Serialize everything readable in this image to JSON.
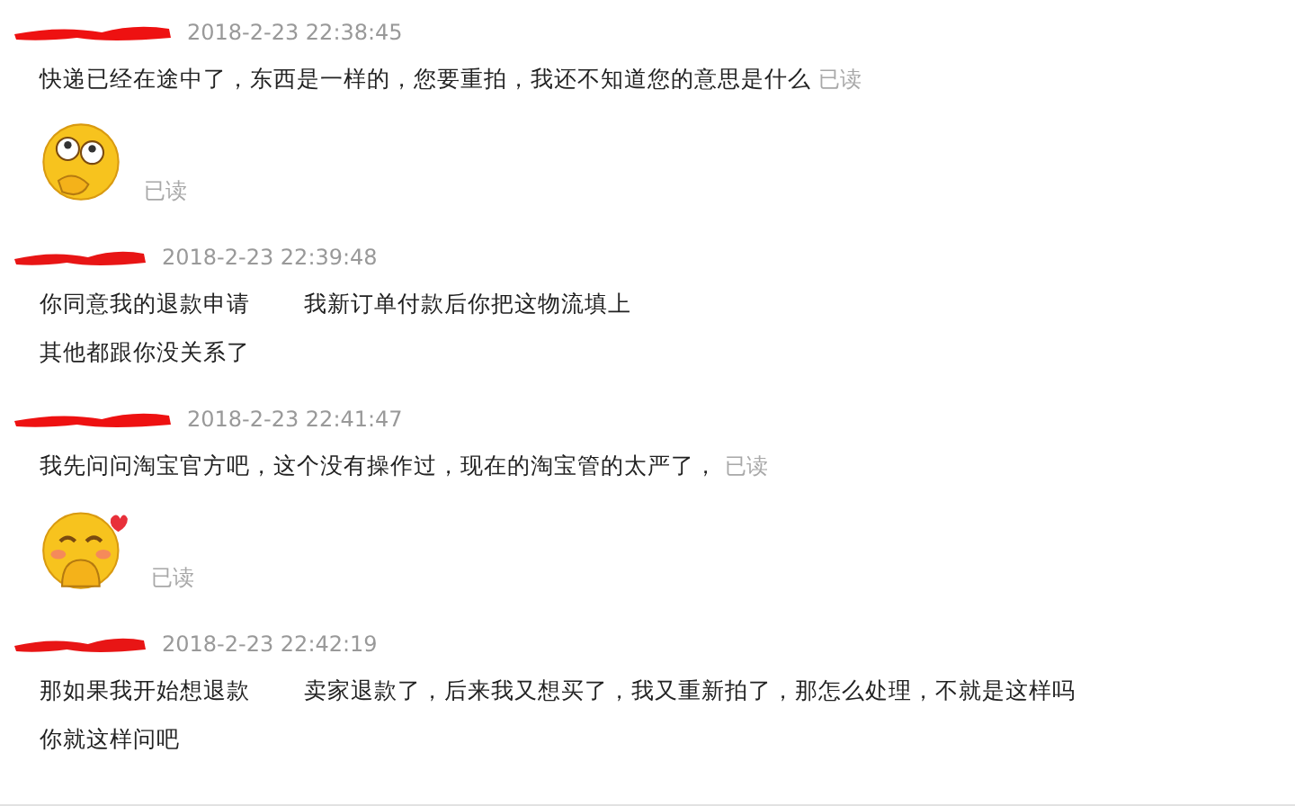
{
  "messages": [
    {
      "kind": "seller",
      "time": "2018-2-23 22:38:45",
      "items": [
        {
          "kind": "text",
          "segments": [
            "快递已经在途中了，东西是一样的，您要重拍，我还不知道您的意思是什么"
          ],
          "receipt": "已读"
        },
        {
          "kind": "thinking_emoji",
          "receipt": "已读"
        }
      ]
    },
    {
      "kind": "buyer",
      "time": "2018-2-23 22:39:48",
      "items": [
        {
          "kind": "text",
          "segments": [
            "你同意我的退款申请",
            "我新订单付款后你把这物流填上"
          ]
        },
        {
          "kind": "text",
          "segments": [
            "其他都跟你没关系了"
          ]
        }
      ]
    },
    {
      "kind": "seller",
      "time": "2018-2-23 22:41:47",
      "items": [
        {
          "kind": "text",
          "segments": [
            "我先问问淘宝官方吧，这个没有操作过，现在的淘宝管的太严了，"
          ],
          "receipt": "已读"
        },
        {
          "kind": "shy_emoji",
          "receipt": "已读"
        }
      ]
    },
    {
      "kind": "buyer",
      "time": "2018-2-23 22:42:19",
      "items": [
        {
          "kind": "text",
          "segments": [
            "那如果我开始想退款",
            "卖家退款了，后来我又想买了，我又重新拍了，那怎么处理，不就是这样吗"
          ]
        },
        {
          "kind": "text",
          "segments": [
            "你就这样问吧"
          ]
        }
      ]
    }
  ]
}
